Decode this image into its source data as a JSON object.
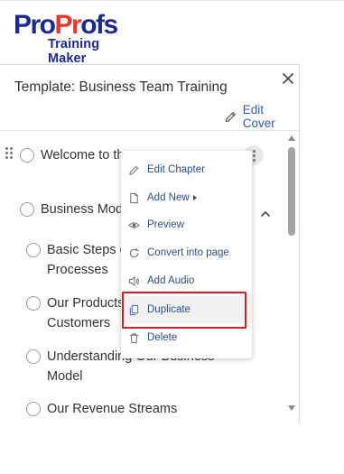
{
  "logo": {
    "part1": "Pro",
    "part2": "Pr",
    "part3": "ofs",
    "tagline": "Training Maker"
  },
  "panel": {
    "template_title": "Template: Business Team Training",
    "edit_cover_label": "Edit Cover"
  },
  "tree": {
    "items": [
      {
        "label": "Welcome to th"
      },
      {
        "label": "Business Mode"
      },
      {
        "line1": "Basic Steps o",
        "line2": "Processes"
      },
      {
        "line1": "Our Products",
        "line2": "Customers"
      },
      {
        "line1": "Understanding Our Business",
        "line2": "Model"
      },
      {
        "label": "Our Revenue Streams"
      }
    ]
  },
  "context_menu": {
    "items": [
      {
        "label": "Edit Chapter",
        "icon": "pencil-icon"
      },
      {
        "label": "Add New",
        "icon": "file-icon"
      },
      {
        "label": "Preview",
        "icon": "eye-icon"
      },
      {
        "label": "Convert into page",
        "icon": "convert-icon"
      },
      {
        "label": "Add Audio",
        "icon": "speaker-icon"
      },
      {
        "label": "Duplicate",
        "icon": "copy-icon"
      },
      {
        "label": "Delete",
        "icon": "trash-icon"
      }
    ]
  },
  "colors": {
    "brand_blue": "#1c2a8f",
    "brand_red": "#e8372f",
    "link_blue": "#2f5f9e",
    "highlight_red": "#d51f24"
  }
}
